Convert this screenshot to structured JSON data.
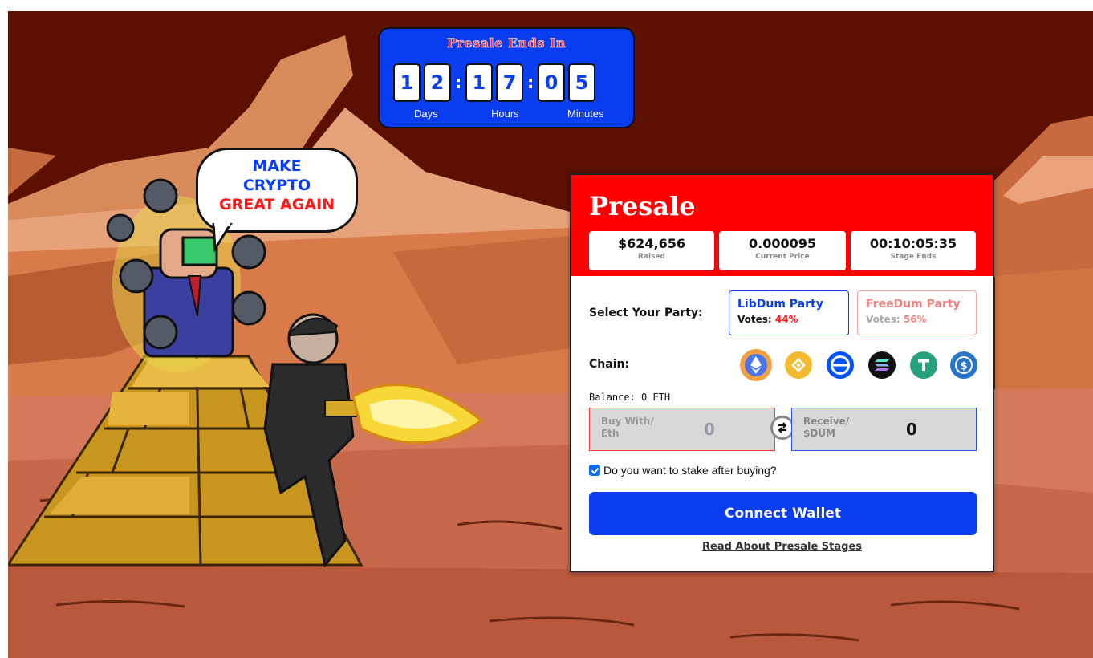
{
  "countdown": {
    "title": "Presale Ends In",
    "digits": [
      "1",
      "2",
      "1",
      "7",
      "0",
      "5"
    ],
    "labels": {
      "days": "Days",
      "hours": "Hours",
      "minutes": "Minutes"
    }
  },
  "bubble": {
    "line1": "MAKE",
    "line2": "CRYPTO",
    "line3": "GREAT AGAIN"
  },
  "presale": {
    "title": "Presale",
    "stats": [
      {
        "value": "$624,656",
        "label": "Raised"
      },
      {
        "value": "0.000095",
        "label": "Current Price"
      },
      {
        "value": "00:10:05:35",
        "label": "Stage Ends"
      }
    ],
    "party": {
      "label": "Select Your Party:",
      "libdum": {
        "name": "LibDum Party",
        "votes_label": "Votes:",
        "votes": "44%"
      },
      "freedum": {
        "name": "FreeDum Party",
        "votes_label": "Votes:",
        "votes": "56%"
      }
    },
    "chain": {
      "label": "Chain:",
      "icons": [
        "ethereum-icon",
        "bnb-icon",
        "other-chain-icon",
        "solana-icon",
        "tether-icon",
        "usdc-icon"
      ]
    },
    "balance": "Balance: 0 ETH",
    "buy": {
      "label_line1": "Buy With/",
      "label_line2": "Eth",
      "value": "0"
    },
    "receive": {
      "label_line1": "Receive/",
      "label_line2": "$DUM",
      "value": "0"
    },
    "stake": {
      "text": "Do you want to stake after buying?",
      "checked": true
    },
    "connect_label": "Connect Wallet",
    "read_link": "Read About Presale Stages"
  },
  "colors": {
    "accent_blue": "#0a3cf0",
    "accent_red": "#ff0000",
    "sky": "#5b1000"
  }
}
